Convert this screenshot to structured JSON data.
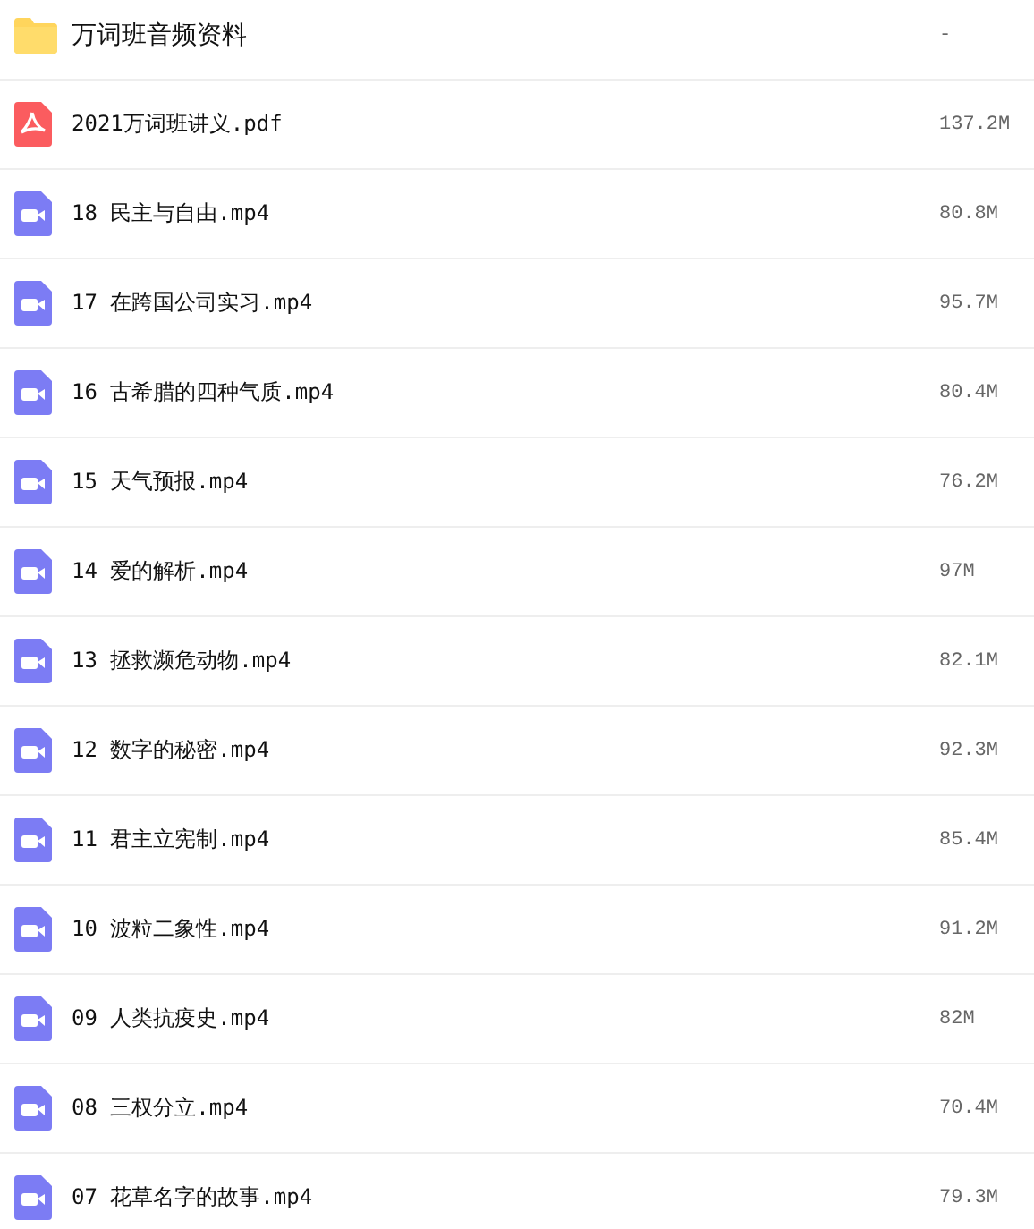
{
  "files": [
    {
      "kind": "folder",
      "name": "万词班音频资料",
      "size": "-"
    },
    {
      "kind": "pdf",
      "name": "2021万词班讲义.pdf",
      "size": "137.2M"
    },
    {
      "kind": "video",
      "name": "18 民主与自由.mp4",
      "size": "80.8M"
    },
    {
      "kind": "video",
      "name": "17 在跨国公司实习.mp4",
      "size": "95.7M"
    },
    {
      "kind": "video",
      "name": "16 古希腊的四种气质.mp4",
      "size": "80.4M"
    },
    {
      "kind": "video",
      "name": "15 天气预报.mp4",
      "size": "76.2M"
    },
    {
      "kind": "video",
      "name": "14 爱的解析.mp4",
      "size": "97M"
    },
    {
      "kind": "video",
      "name": "13 拯救濒危动物.mp4",
      "size": "82.1M"
    },
    {
      "kind": "video",
      "name": "12 数字的秘密.mp4",
      "size": "92.3M"
    },
    {
      "kind": "video",
      "name": "11 君主立宪制.mp4",
      "size": "85.4M"
    },
    {
      "kind": "video",
      "name": "10 波粒二象性.mp4",
      "size": "91.2M"
    },
    {
      "kind": "video",
      "name": "09 人类抗疫史.mp4",
      "size": "82M"
    },
    {
      "kind": "video",
      "name": "08 三权分立.mp4",
      "size": "70.4M"
    },
    {
      "kind": "video",
      "name": "07 花草名字的故事.mp4",
      "size": "79.3M"
    }
  ]
}
